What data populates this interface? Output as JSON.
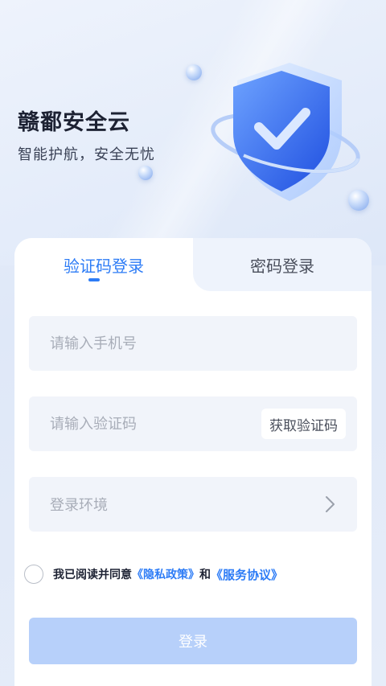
{
  "header": {
    "title": "赣鄱安全云",
    "subtitle": "智能护航，安全无忧"
  },
  "tabs": [
    {
      "label": "验证码登录",
      "active": true
    },
    {
      "label": "密码登录",
      "active": false
    }
  ],
  "form": {
    "phone_placeholder": "请输入手机号",
    "code_placeholder": "请输入验证码",
    "get_code_label": "获取验证码",
    "env_label": "登录环境"
  },
  "agreement": {
    "prefix": "我已阅读并同意",
    "privacy": "《隐私政策》",
    "conj": "和",
    "service": "《服务协议》",
    "checked": false
  },
  "login_label": "登录",
  "colors": {
    "accent": "#2d7cf6",
    "button_disabled": "#b7d0fa"
  }
}
